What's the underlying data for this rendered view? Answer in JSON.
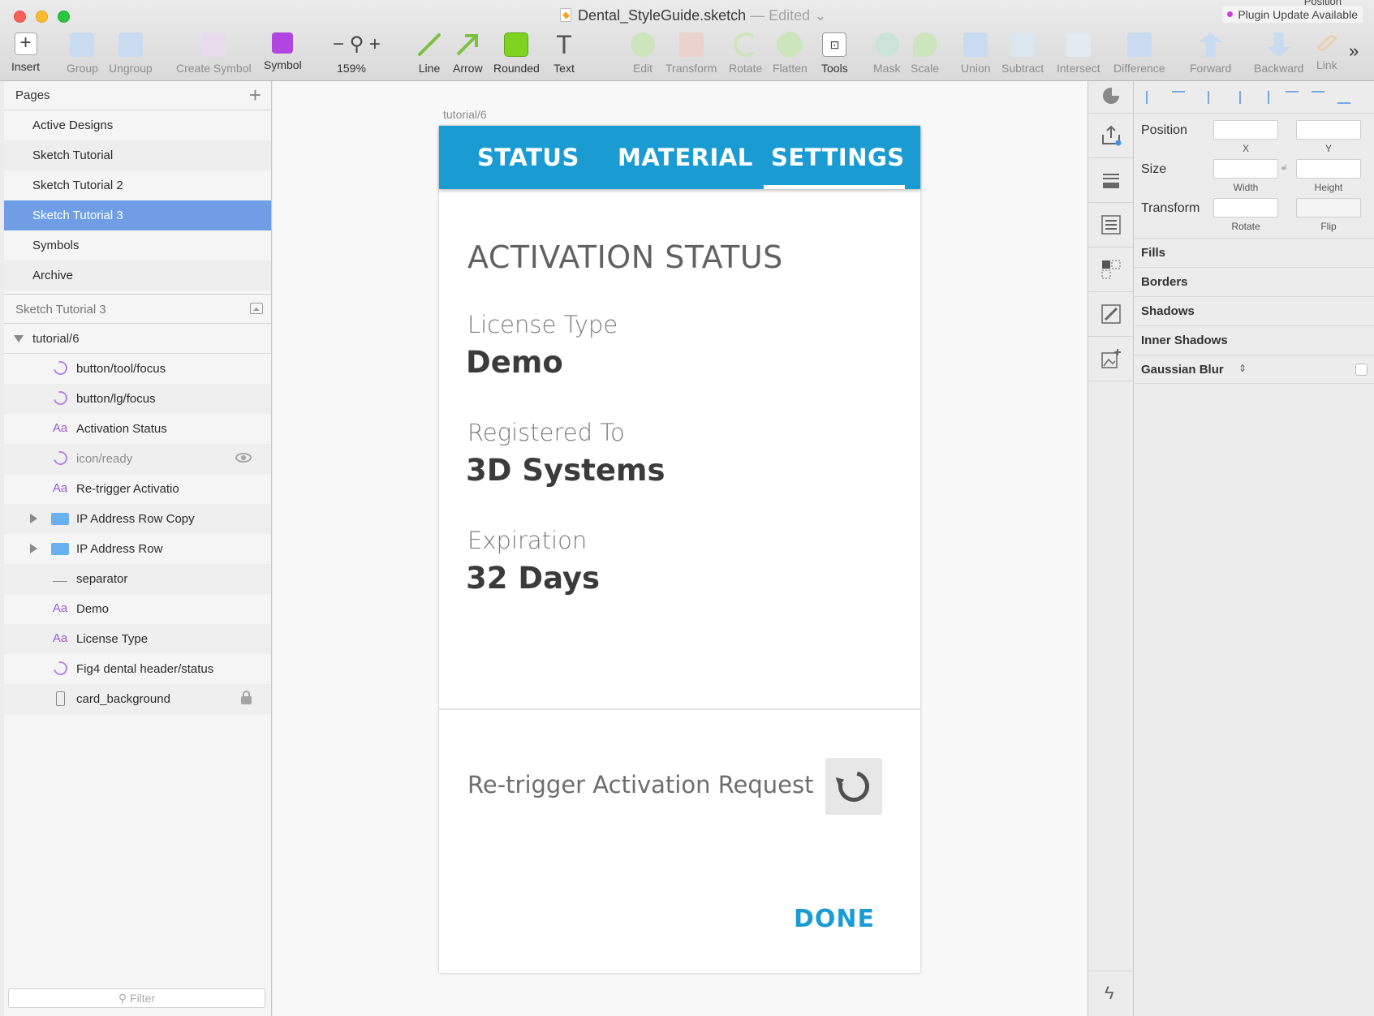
{
  "window": {
    "doc_name": "Dental_StyleGuide.sketch",
    "edited_label": "— Edited",
    "plugin_update": "Plugin Update Available",
    "position_peek": "Position"
  },
  "toolbar": {
    "insert": "Insert",
    "group": "Group",
    "ungroup": "Ungroup",
    "create_symbol": "Create Symbol",
    "symbol": "Symbol",
    "zoom_level": "159%",
    "line": "Line",
    "arrow": "Arrow",
    "rounded": "Rounded",
    "text": "Text",
    "edit": "Edit",
    "transform": "Transform",
    "rotate": "Rotate",
    "flatten": "Flatten",
    "tools": "Tools",
    "mask": "Mask",
    "scale": "Scale",
    "union": "Union",
    "subtract": "Subtract",
    "intersect": "Intersect",
    "difference": "Difference",
    "forward": "Forward",
    "backward": "Backward",
    "link": "Link",
    "more": "»"
  },
  "pages": {
    "header": "Pages",
    "add": "+",
    "items": [
      {
        "label": "Active Designs"
      },
      {
        "label": "Sketch Tutorial"
      },
      {
        "label": "Sketch Tutorial 2"
      },
      {
        "label": "Sketch Tutorial 3"
      },
      {
        "label": "Symbols"
      },
      {
        "label": "Archive"
      }
    ],
    "selected": "Sketch Tutorial 3"
  },
  "layers": {
    "header": "Sketch Tutorial 3",
    "artboard": "tutorial/6",
    "items": [
      {
        "icon": "symbol",
        "label": "button/tool/focus"
      },
      {
        "icon": "symbol",
        "label": "button/lg/focus"
      },
      {
        "icon": "text",
        "label": "Activation Status"
      },
      {
        "icon": "symbol",
        "label": "icon/ready"
      },
      {
        "icon": "text",
        "label": "Re-trigger Activatio"
      },
      {
        "icon": "folder",
        "label": "IP Address Row Copy"
      },
      {
        "icon": "folder",
        "label": "IP Address Row"
      },
      {
        "icon": "line",
        "label": "separator"
      },
      {
        "icon": "text",
        "label": "Demo"
      },
      {
        "icon": "text",
        "label": "License Type"
      },
      {
        "icon": "symbol",
        "label": "Fig4 dental header/status"
      },
      {
        "icon": "rect",
        "label": "card_background"
      }
    ],
    "text_icon": "Aa",
    "filter_placeholder": "Filter"
  },
  "canvas": {
    "artboard_label": "tutorial/6",
    "tabs": [
      "STATUS",
      "MATERIAL",
      "SETTINGS"
    ],
    "active_tab": "SETTINGS",
    "title": "ACTIVATION STATUS",
    "fields": [
      {
        "label": "License Type",
        "value": "Demo"
      },
      {
        "label": "Registered To",
        "value": "3D Systems"
      },
      {
        "label": "Expiration",
        "value": "32 Days"
      }
    ],
    "retrigger_label": "Re-trigger Activation Request",
    "done_label": "DONE",
    "accent_color": "#1a9cd3"
  },
  "inspector": {
    "position": "Position",
    "x": "X",
    "y": "Y",
    "size": "Size",
    "width": "Width",
    "height": "Height",
    "transform": "Transform",
    "rotate": "Rotate",
    "flip": "Flip",
    "sections": [
      "Fills",
      "Borders",
      "Shadows",
      "Inner Shadows",
      "Gaussian Blur"
    ]
  }
}
